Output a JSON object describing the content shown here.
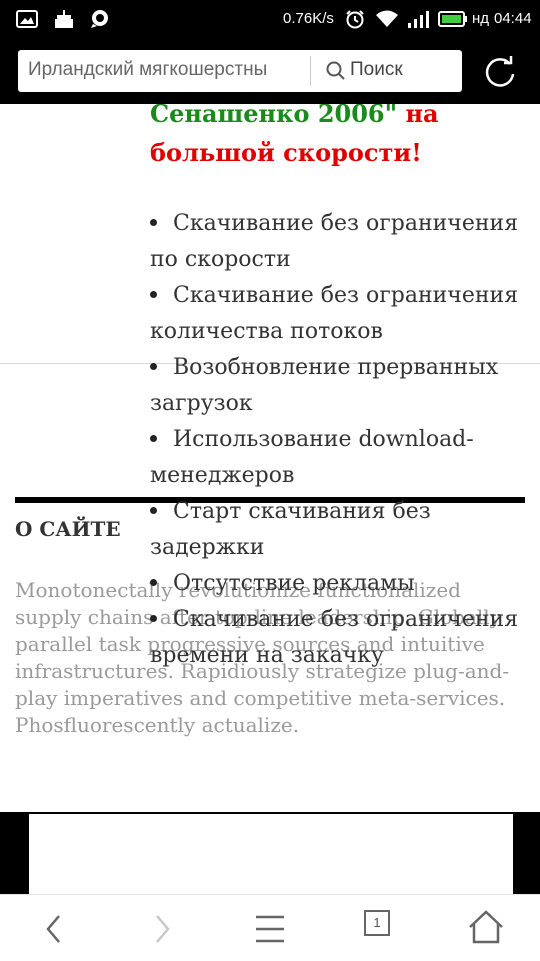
{
  "status_bar": {
    "speed": "0.76K/s",
    "carrier": "нд",
    "time": "04:44"
  },
  "toolbar": {
    "search_value": "Ирландский мягкошерстны",
    "search_label": "Поиск"
  },
  "heading": {
    "green_text": "Сенашенко 2006\"",
    "red_text": "на большой скорости!"
  },
  "features": [
    "Скачивание без ограничения по скорости",
    "Скачивание без ограничения количества потоков",
    "Возобновление прерванных загрузок",
    "Использование download-менеджеров",
    "Старт скачивания без задержки",
    "Отсутствие рекламы",
    "Скачивание без ограничения времени на закачку"
  ],
  "about": {
    "title": "О САЙТЕ",
    "text": "Monotonectally revolutionize functionalized supply chains after top-line leadership. Globally parallel task progressive sources and intuitive infrastructures. Rapidiously strategize plug-and-play imperatives and competitive meta-services. Phosfluorescently actualize."
  },
  "nav": {
    "tab_count": "1"
  },
  "colors": {
    "green": "#1a8a1a",
    "red": "#e00000",
    "toolbar_bg": "#000000"
  }
}
